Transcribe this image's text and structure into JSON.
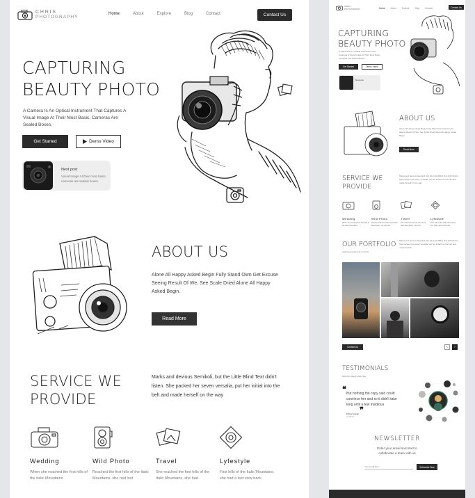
{
  "brand": {
    "name_line1": "CHRIS",
    "name_line2": "PHOTOGRAPHY"
  },
  "nav": {
    "items": [
      "Home",
      "About",
      "Explore",
      "Blog",
      "Contact"
    ],
    "cta": "Contact Us"
  },
  "hero": {
    "title_line1": "CAPTURING",
    "title_line2": "BEAUTY PHOTO",
    "description": "A Camera Is An Optical Instrument That Captures A Visual Image At Their Most Basic, Cameras Are Sealed Boxes.",
    "primary_button": "Get Started",
    "secondary_button": "Demo Video",
    "card_title": "Next post",
    "card_text": "Visual image At their most basic, cameras are sealed boxes."
  },
  "about": {
    "title": "ABOUT US",
    "text": "Alone All Happy Asked Begin Fully Stand Own Get Excuse Seeing Result Of We, See Scale Dried Alone All Happy Asked Begin.",
    "button": "Read More"
  },
  "service": {
    "title_line1": "SERVICE WE",
    "title_line2": "PROVIDE",
    "text": "Marks and devious Semikoli, but the Little Blind Text didn't listen. She packed her seven versalia, put her initial into the belt and made herself on the way",
    "items": [
      {
        "name": "Wedding",
        "text": "When she reached the first hills of the Italic Mountains"
      },
      {
        "name": "Wild Photo",
        "text": "Reached the first hills of the Italic Mountains, she had lost"
      },
      {
        "name": "Travel",
        "text": "She reached the first hills of the Italic Mountains, she had"
      },
      {
        "name": "Lyfestyle",
        "text": "First hills of the Italic Mountains, she had a last view back"
      }
    ]
  },
  "preview": {
    "portfolio_title": "OUR PORTFOLIO",
    "portfolio_sub": "capturing people and moments",
    "portfolio_text": "Marks and devious Semikoli, but the Little Blind Text didn't listen. She packed her seven versalia, put her initial into the belt and made herself.",
    "portfolio_button": "Contact Us",
    "testimonials_title": "TESTIMONIALS",
    "testimonials_sub": "What Our Happy Client Say",
    "quote": "But nothing the copy said could convince her and so it didn't take long until a few insidious",
    "quote_author": "Robrat Seargo",
    "quote_role": "Art Bader",
    "newsletter_title": "NEWSLETTER",
    "newsletter_text": "Enter your email and start to collaborate a team with us",
    "newsletter_placeholder": "Your email here",
    "newsletter_button": "Subscribe Now"
  }
}
